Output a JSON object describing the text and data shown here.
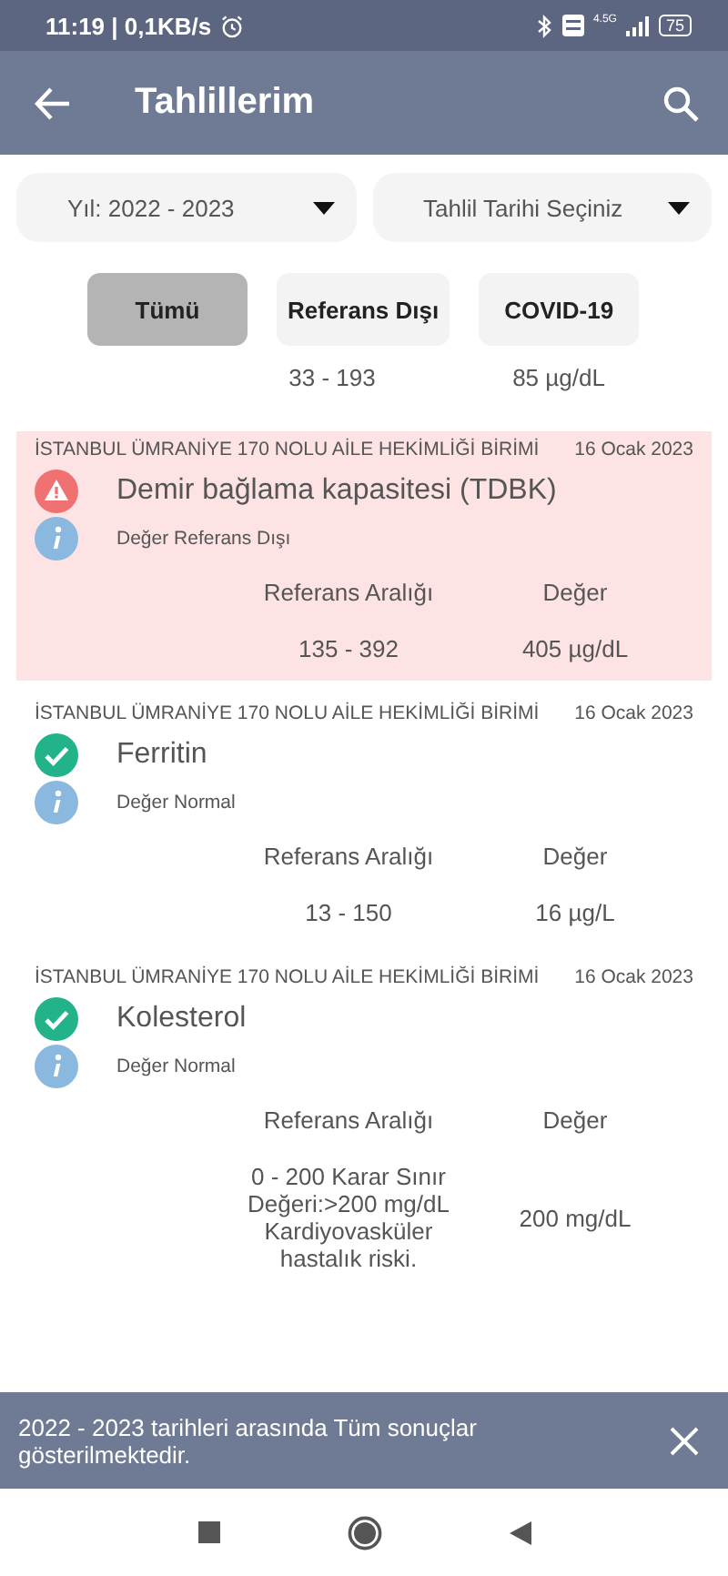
{
  "status_bar": {
    "time": "11:19 | 0,1KB/s",
    "network": "4.5G",
    "battery": "75"
  },
  "header": {
    "title": "Tahlillerim"
  },
  "filters": [
    {
      "label": "Yıl: 2022 - 2023"
    },
    {
      "label": "Tahlil Tarihi Seçiniz"
    }
  ],
  "chips": [
    {
      "label": "Tümü",
      "selected": true
    },
    {
      "label": "Referans Dışı",
      "selected": false
    },
    {
      "label": "COVID-19",
      "selected": false
    }
  ],
  "partial_row": {
    "range": "33 - 193",
    "value": "85 µg/dL"
  },
  "results": [
    {
      "clinic": "İSTANBUL ÜMRANİYE 170 NOLU AİLE HEKİMLİĞİ BİRİMİ",
      "date": "16 Ocak 2023",
      "name": "Demir bağlama kapasitesi (TDBK)",
      "kind": "alert",
      "note": "Değer Referans Dışı",
      "range_label": "Referans Aralığı",
      "value_label": "Değer",
      "range": "135 - 392",
      "value": "405 µg/dL"
    },
    {
      "clinic": "İSTANBUL ÜMRANİYE 170 NOLU AİLE HEKİMLİĞİ BİRİMİ",
      "date": "16 Ocak 2023",
      "name": "Ferritin",
      "kind": "ok",
      "note": "Değer Normal",
      "range_label": "Referans Aralığı",
      "value_label": "Değer",
      "range": "13 - 150",
      "value": "16 µg/L"
    },
    {
      "clinic": "İSTANBUL ÜMRANİYE 170 NOLU AİLE HEKİMLİĞİ BİRİMİ",
      "date": "16 Ocak 2023",
      "name": "Kolesterol",
      "kind": "ok",
      "note": "Değer Normal",
      "range_label": "Referans Aralığı",
      "value_label": "Değer",
      "range": "0 - 200 Karar Sınır Değeri:>200 mg/dL Kardiyovasküler hastalık riski.",
      "value": "200 mg/dL"
    }
  ],
  "snackbar": {
    "message": "2022 - 2023 tarihleri arasında Tüm sonuçlar gösterilmektedir."
  }
}
